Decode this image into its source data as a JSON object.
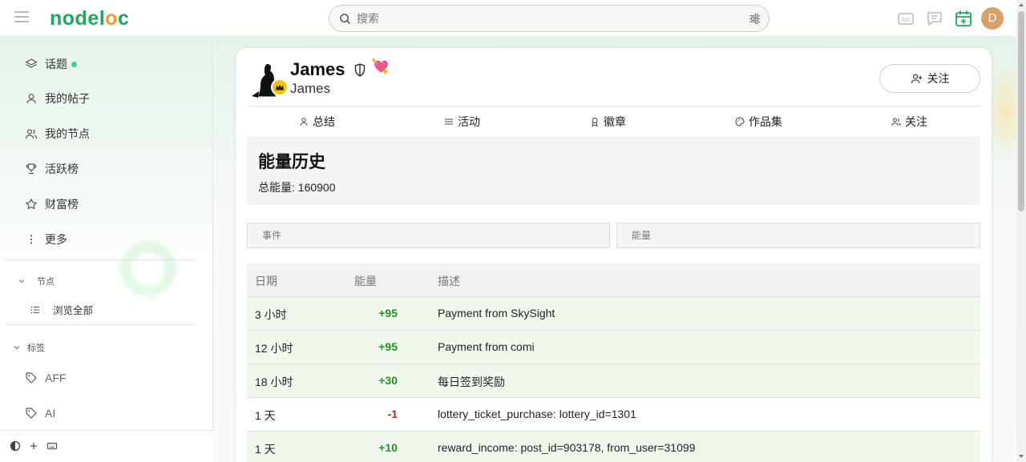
{
  "header": {
    "logo_part1": "node",
    "logo_part2": "l",
    "logo_part3": "o",
    "logo_part4": "c",
    "search_placeholder": "搜索",
    "avatar_letter": "D"
  },
  "sidebar": {
    "items": [
      {
        "label": "话题",
        "icon": "layers-icon",
        "has_dot": true
      },
      {
        "label": "我的帖子",
        "icon": "user-icon"
      },
      {
        "label": "我的节点",
        "icon": "users-icon"
      },
      {
        "label": "活跃榜",
        "icon": "trophy-icon"
      },
      {
        "label": "财富榜",
        "icon": "star-icon"
      },
      {
        "label": "更多",
        "icon": "more-vertical-icon"
      }
    ],
    "nodes_section": {
      "title": "节点",
      "items": [
        {
          "label": "浏览全部",
          "icon": "list-icon"
        }
      ]
    },
    "tags_section": {
      "title": "标签",
      "items": [
        {
          "label": "AFF",
          "icon": "tag-icon"
        },
        {
          "label": "AI",
          "icon": "tag-icon"
        }
      ]
    }
  },
  "profile": {
    "name": "James",
    "handle": "James",
    "follow_label": "关注",
    "badge_emoji": "💘"
  },
  "tabs": [
    {
      "label": "总结",
      "icon": "user-icon"
    },
    {
      "label": "活动",
      "icon": "list-icon"
    },
    {
      "label": "徽章",
      "icon": "award-icon"
    },
    {
      "label": "作品集",
      "icon": "palette-icon"
    },
    {
      "label": "关注",
      "icon": "users-icon"
    }
  ],
  "energy": {
    "title": "能量历史",
    "total_label": "总能量: 160900"
  },
  "filters": {
    "event_placeholder": "事件",
    "energy_placeholder": "能量"
  },
  "table": {
    "columns": [
      "日期",
      "能量",
      "描述"
    ],
    "rows": [
      {
        "date": "3 小时",
        "amount": "+95",
        "desc": "Payment from SkySight",
        "sign": "plus"
      },
      {
        "date": "12 小时",
        "amount": "+95",
        "desc": "Payment from comi",
        "sign": "plus"
      },
      {
        "date": "18 小时",
        "amount": "+30",
        "desc": "每日签到奖励",
        "sign": "plus"
      },
      {
        "date": "1 天",
        "amount": "-1",
        "desc": "lottery_ticket_purchase: lottery_id=1301",
        "sign": "minus"
      },
      {
        "date": "1 天",
        "amount": "+10",
        "desc": "reward_income: post_id=903178, from_user=31099",
        "sign": "plus"
      }
    ]
  },
  "colors": {
    "brand_green": "#1fa85a",
    "brand_orange": "#f29a2e",
    "positive": "#1a9a1a",
    "negative": "#d01b1b",
    "avatar_bg": "#d9a06a"
  }
}
